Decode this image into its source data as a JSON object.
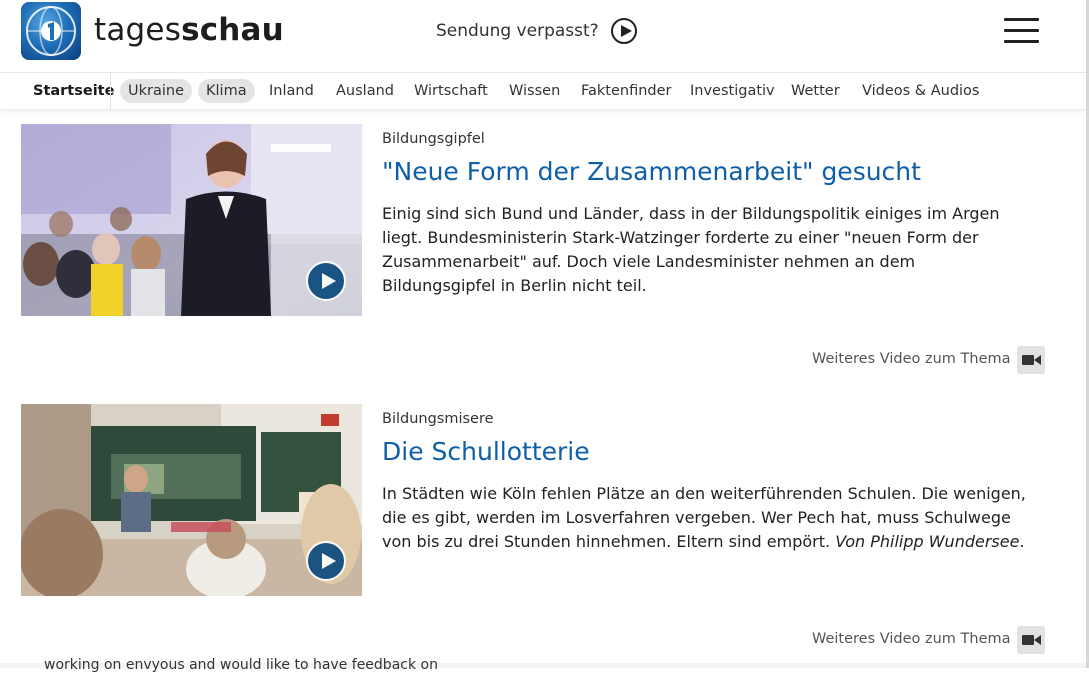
{
  "header": {
    "brand_regular": "tages",
    "brand_bold": "schau",
    "sendung_label": "Sendung verpasst?"
  },
  "nav": {
    "items": [
      {
        "label": "Startseite"
      },
      {
        "label": "Ukraine"
      },
      {
        "label": "Klima"
      },
      {
        "label": "Inland"
      },
      {
        "label": "Ausland"
      },
      {
        "label": "Wirtschaft"
      },
      {
        "label": "Wissen"
      },
      {
        "label": "Faktenfinder"
      },
      {
        "label": "Investigativ"
      },
      {
        "label": "Wetter"
      },
      {
        "label": "Videos & Audios"
      }
    ]
  },
  "articles": [
    {
      "topline": "Bildungsgipfel",
      "headline": "\"Neue Form der Zusammenarbeit\" gesucht",
      "text": "Einig sind sich Bund und Länder, dass in der Bildungspolitik einiges im Argen liegt. Bundesministerin Stark-Watzinger forderte zu einer \"neuen Form der Zusammenarbeit\" auf. Doch viele Landesminister nehmen an dem Bildungsgipfel in Berlin nicht teil.",
      "more_label": "Weiteres Video zum Thema"
    },
    {
      "topline": "Bildungsmisere",
      "headline": "Die Schullotterie",
      "text": "In Städten wie Köln fehlen Plätze an den weiterführenden Schulen. Die wenigen, die es gibt, werden im Losverfahren vergeben. Wer Pech hat, muss Schulwege von bis zu drei Stunden hinnehmen. Eltern sind empört.",
      "author": "Von Philipp Wundersee",
      "author_suffix": ".",
      "more_label": "Weiteres Video zum Thema"
    }
  ],
  "footer_cutoff_text": "working on envyous and would like to have feedback on",
  "icons": {
    "logo": "tagesschau-globe-logo",
    "sendung": "play-circle-icon",
    "menu": "hamburger-menu-icon",
    "video": "video-camera-icon",
    "play": "play-icon"
  },
  "colors": {
    "headline": "#0f5ea8",
    "video_button": "#0b4a7e",
    "pill_bg": "#e4e4e4"
  }
}
